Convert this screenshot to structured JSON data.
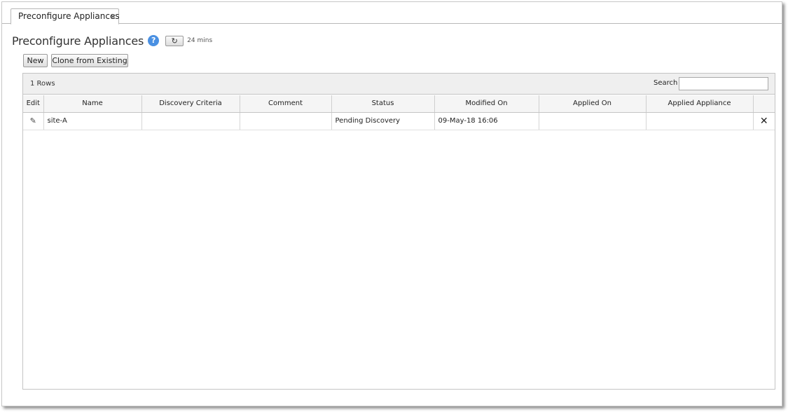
{
  "tabs": [
    {
      "label": "Preconfigure Appliances",
      "close_glyph": "×"
    }
  ],
  "header": {
    "title": "Preconfigure Appliances",
    "help_glyph": "?",
    "refresh_glyph": "↻",
    "last_refresh": "24 mins"
  },
  "toolbar": {
    "new_label": "New",
    "clone_label": "Clone from Existing"
  },
  "grid": {
    "row_count": "1 Rows",
    "search_label": "Search",
    "search_value": "",
    "columns": [
      "Edit",
      "Name",
      "Discovery Criteria",
      "Comment",
      "Status",
      "Modified On",
      "Applied On",
      "Applied Appliance",
      ""
    ],
    "rows": [
      {
        "edit_icon": "pencil-icon",
        "name": "site-A",
        "discovery_criteria": "",
        "comment": "",
        "status": "Pending Discovery",
        "modified_on": "09-May-18 16:06",
        "applied_on": "",
        "applied_appliance": "",
        "delete_icon": "close-icon"
      }
    ]
  },
  "colors": {
    "help_icon": "#4a90e2",
    "toolbar_bg": "#efefef",
    "header_bg": "#f5f5f5"
  }
}
